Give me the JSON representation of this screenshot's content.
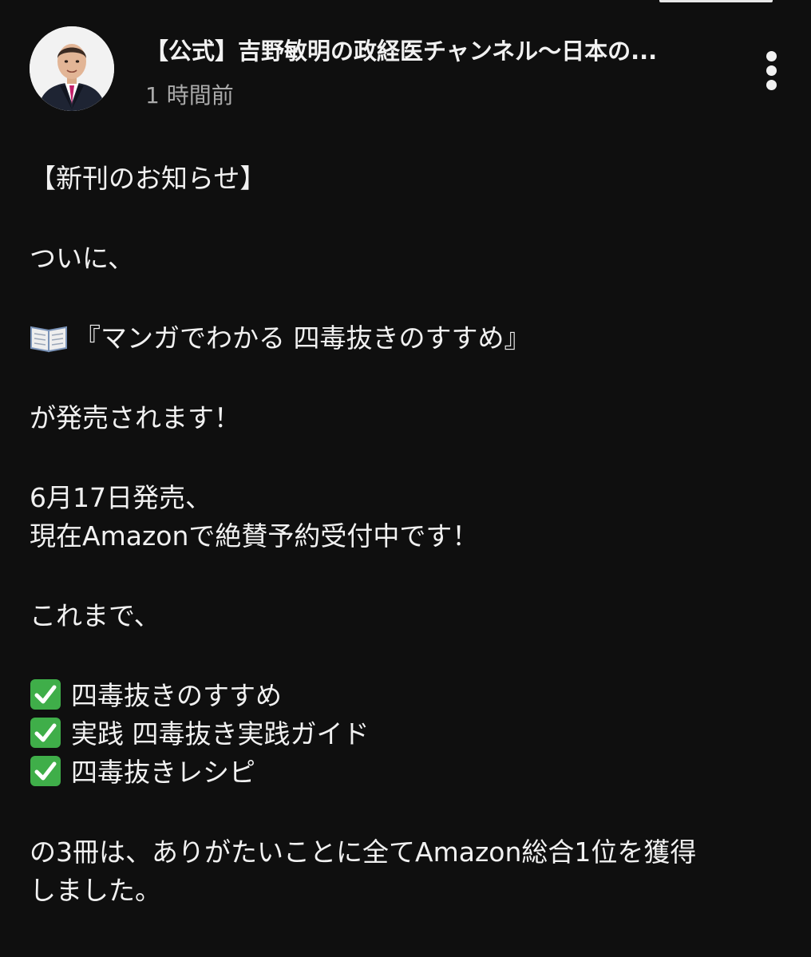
{
  "post": {
    "channel_name": "【公式】吉野敏明の政経医チャンネル〜日本の...",
    "timestamp": "1 時間前",
    "menu_icon": "more-vert-icon",
    "avatar_icon": "avatar-photo",
    "body": {
      "heading": "【新刊のお知らせ】",
      "line_finally": "ついに、",
      "book_icon": "open-book-icon",
      "book_title": "『マンガでわかる 四毒抜きのすすめ』",
      "line_release": "が発売されます！",
      "release_date": "6月17日発売、",
      "preorder": "現在Amazonで絶賛予約受付中です！",
      "line_so_far": "これまで、",
      "check_icon": "check-mark-button-icon",
      "books": [
        "四毒抜きのすすめ",
        "実践 四毒抜き実践ガイド",
        "四毒抜きレシピ"
      ],
      "closing_line1": "の3冊は、ありがたいことに全てAmazon総合1位を獲得",
      "closing_line2": "しました。"
    }
  },
  "colors": {
    "background": "#0f0f0f",
    "text_primary": "#f1f1f1",
    "text_secondary": "#aaaaaa",
    "check_green": "#3fae49"
  }
}
